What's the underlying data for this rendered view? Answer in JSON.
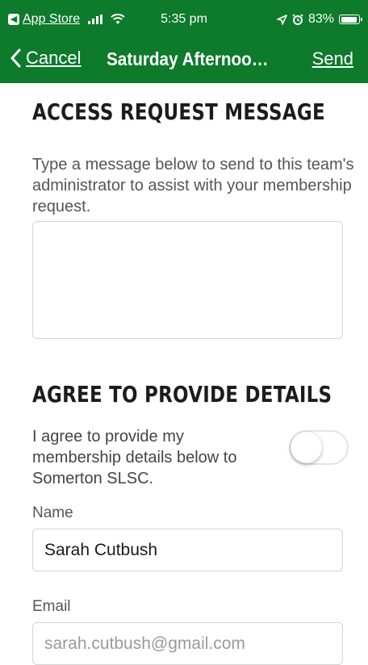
{
  "status_bar": {
    "back_app_label": "App Store",
    "time": "5:35 pm",
    "battery_percent": "83%",
    "battery_level": 0.83
  },
  "nav": {
    "cancel_label": "Cancel",
    "title": "Saturday Afternoon…",
    "send_label": "Send"
  },
  "access_request": {
    "heading": "ACCESS REQUEST MESSAGE",
    "help_text": "Type a message below to send to this team's administrator to assist with your membership request.",
    "message_value": ""
  },
  "agree": {
    "heading": "AGREE TO PROVIDE DETAILS",
    "text": "I agree to provide my membership details below to Somerton SLSC.",
    "toggle_on": false
  },
  "fields": {
    "name_label": "Name",
    "name_value": "Sarah Cutbush",
    "email_label": "Email",
    "email_value": "sarah.cutbush@gmail.com"
  },
  "colors": {
    "header_bg": "#0d7a2c",
    "header_text": "#ffffff"
  }
}
